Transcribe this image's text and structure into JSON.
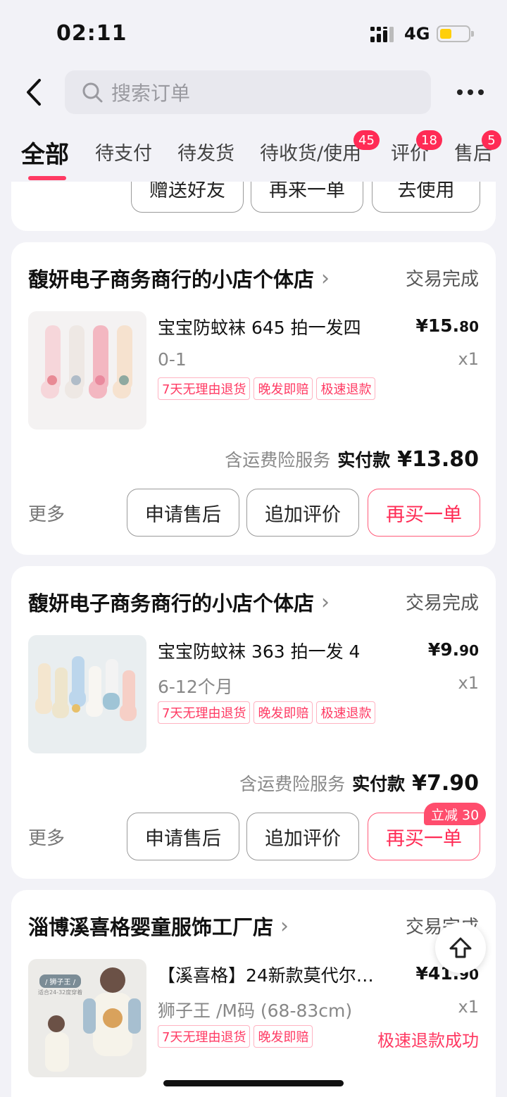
{
  "status_bar": {
    "time": "02:11",
    "network": "4G",
    "signal_icon": "signal-icon",
    "battery_icon": "battery-icon"
  },
  "header": {
    "back_icon": "chevron-left-icon",
    "search_placeholder": "搜索订单",
    "search_icon": "search-icon",
    "more_icon": "more-icon"
  },
  "tabs": [
    {
      "label": "全部",
      "active": true
    },
    {
      "label": "待支付"
    },
    {
      "label": "待发货"
    },
    {
      "label": "待收货/使用",
      "badge": "45"
    },
    {
      "label": "评价",
      "badge": "18"
    },
    {
      "label": "售后",
      "badge": "5"
    }
  ],
  "partial_card": {
    "buttons": [
      "赠送好友",
      "再来一单",
      "去使用"
    ]
  },
  "orders": [
    {
      "shop": "馥妍电子商务商行的小店个体店",
      "status": "交易完成",
      "title": "宝宝防蚊袜 645 拍一发四",
      "spec": "0-1",
      "price_main": "¥15.",
      "price_cents": "80",
      "qty": "x1",
      "tags": [
        "7天无理由退货",
        "晚发即赔",
        "极速退款"
      ],
      "service": "含运费险服务",
      "paid_label": "实付款",
      "paid_amount": "¥13.80",
      "more": "更多",
      "buttons": [
        "申请售后",
        "追加评价",
        "再买一单"
      ]
    },
    {
      "shop": "馥妍电子商务商行的小店个体店",
      "status": "交易完成",
      "title": "宝宝防蚊袜 363 拍一发 4",
      "spec": "6-12个月",
      "price_main": "¥9.",
      "price_cents": "90",
      "qty": "x1",
      "tags": [
        "7天无理由退货",
        "晚发即赔",
        "极速退款"
      ],
      "service": "含运费险服务",
      "paid_label": "实付款",
      "paid_amount": "¥7.90",
      "more": "更多",
      "buttons": [
        "申请售后",
        "追加评价",
        "再买一单"
      ],
      "promo": "立减 30"
    },
    {
      "shop": "淄博溪喜格婴童服饰工厂店",
      "status": "交易完成",
      "title": "【溪喜格】24新款莫代尔…",
      "spec": "狮子王 /M码 (68-83cm)",
      "price_main": "¥41.",
      "price_cents": "90",
      "qty": "x1",
      "tags": [
        "7天无理由退货",
        "晚发即赔"
      ],
      "refund_status": "极速退款成功",
      "thumb_label": "/ 狮子王 /",
      "thumb_sub": "适合24-32度穿着"
    }
  ],
  "float_button_icon": "arrow-up-icon"
}
